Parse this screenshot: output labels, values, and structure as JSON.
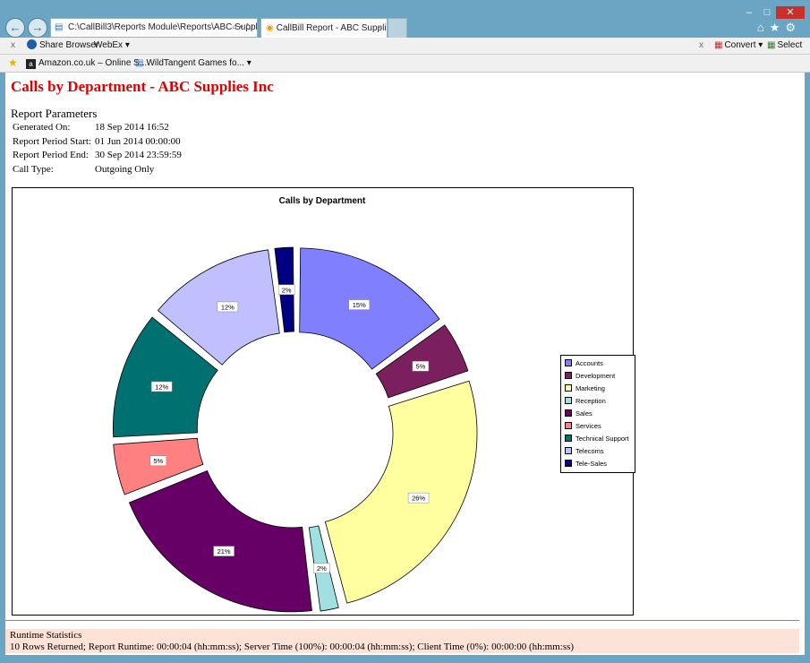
{
  "browser": {
    "address": "C:\\CallBill3\\Reports Module\\Reports\\ABC Suppli",
    "address_controls": "⌕ ▾ ↻",
    "tab_title": "CallBill Report - ABC Suppli...",
    "tab_close": "×",
    "back": "←",
    "forward": "→"
  },
  "toolbar": {
    "close_x": "x",
    "share_browser": "Share Browser",
    "webex": "WebEx",
    "dropdown_caret": "▾",
    "right_close_x": "x",
    "convert": "Convert",
    "select": "Select"
  },
  "favorites": {
    "items": [
      "Amazon.co.uk – Online S...",
      "WildTangent Games fo..."
    ]
  },
  "report": {
    "title": "Calls by Department - ABC Supplies Inc",
    "params_heading": "Report Parameters",
    "params": [
      {
        "label": "Generated On:",
        "value": "18 Sep 2014 16:52"
      },
      {
        "label": "Report Period Start:",
        "value": "01 Jun 2014 00:00:00"
      },
      {
        "label": "Report Period End:",
        "value": "30 Sep 2014 23:59:59"
      },
      {
        "label": "Call Type:",
        "value": "Outgoing Only"
      }
    ]
  },
  "stats": {
    "heading": "Runtime Statistics",
    "line": "10 Rows Returned; Report Runtime: 00:00:04 (hh:mm:ss); Server Time (100%): 00:00:04 (hh:mm:ss); Client Time (0%): 00:00:00 (hh:mm:ss)"
  },
  "chart_data": {
    "type": "pie",
    "variant": "doughnut-exploded",
    "title": "Calls by Department",
    "legend_position": "right",
    "slices": [
      {
        "name": "Accounts",
        "value": 15,
        "label": "15%",
        "color": "#8080ff"
      },
      {
        "name": "Development",
        "value": 5,
        "label": "5%",
        "color": "#7b1f5e"
      },
      {
        "name": "Marketing",
        "value": 26,
        "label": "26%",
        "color": "#ffffa0"
      },
      {
        "name": "Reception",
        "value": 2,
        "label": "2%",
        "color": "#a0e0e0"
      },
      {
        "name": "Sales",
        "value": 21,
        "label": "21%",
        "color": "#660066"
      },
      {
        "name": "Services",
        "value": 5,
        "label": "5%",
        "color": "#ff8080"
      },
      {
        "name": "Technical Support",
        "value": 12,
        "label": "12%",
        "color": "#007070"
      },
      {
        "name": "Telecoms",
        "value": 12,
        "label": "12%",
        "color": "#c0c0ff"
      },
      {
        "name": "Tele-Sales",
        "value": 2,
        "label": "2%",
        "color": "#000080"
      }
    ]
  }
}
